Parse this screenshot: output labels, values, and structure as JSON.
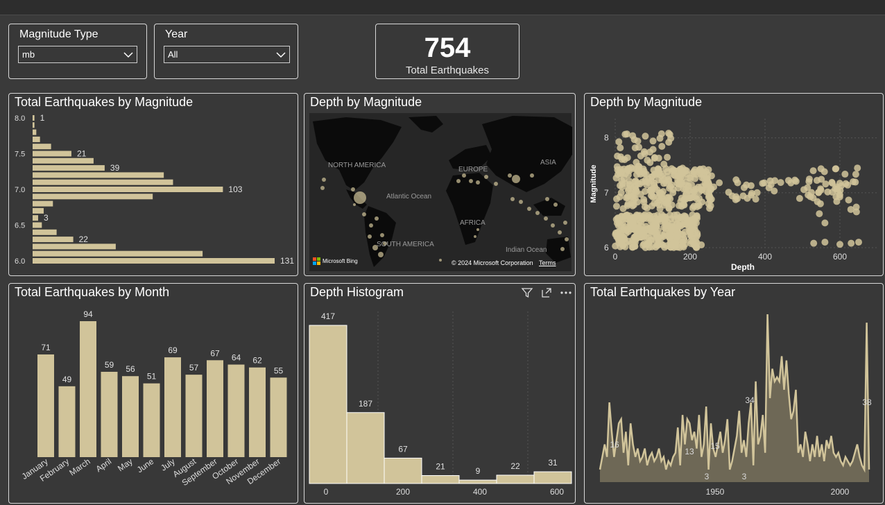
{
  "colors": {
    "bar": "#d1c49a",
    "background": "#383838",
    "border": "#d8d8d8",
    "text": "#ffffff",
    "muted": "#cccccc"
  },
  "slicers": {
    "magnitude": {
      "label": "Magnitude Type",
      "value": "mb"
    },
    "year": {
      "label": "Year",
      "value": "All"
    }
  },
  "kpi": {
    "value": "754",
    "label": "Total Earthquakes"
  },
  "magnitude_chart": {
    "title": "Total Earthquakes by Magnitude",
    "y_ticks": [
      "8.0",
      "7.5",
      "7.0",
      "6.5",
      "6.0"
    ],
    "data_labels": [
      "1",
      "21",
      "39",
      "103",
      "3",
      "22",
      "131"
    ]
  },
  "map_chart": {
    "title": "Depth by Magnitude",
    "labels": {
      "north_america": "NORTH AMERICA",
      "europe": "EUROPE",
      "asia": "ASIA",
      "atlantic": "Atlantic Ocean",
      "africa": "AFRICA",
      "south_america": "SOUTH AMERICA",
      "indian": "Indian Ocean"
    },
    "bing": "Microsoft Bing",
    "copyright": "© 2024 Microsoft Corporation",
    "terms": "Terms"
  },
  "scatter_chart": {
    "title": "Depth by Magnitude",
    "xlabel": "Depth",
    "ylabel": "Magnitude",
    "x_ticks": [
      "0",
      "200",
      "400",
      "600"
    ],
    "y_ticks": [
      "8",
      "7",
      "6"
    ]
  },
  "month_chart": {
    "title": "Total Earthquakes by Month"
  },
  "histogram_chart": {
    "title": "Depth Histogram",
    "x_ticks": [
      "0",
      "200",
      "400",
      "600"
    ]
  },
  "year_chart": {
    "title": "Total Earthquakes by Year",
    "x_ticks": [
      "1950",
      "2000"
    ],
    "data_labels": [
      "16",
      "13",
      "15",
      "3",
      "3",
      "34",
      "38"
    ]
  },
  "chart_data": [
    {
      "type": "bar",
      "orientation": "horizontal",
      "title": "Total Earthquakes by Magnitude",
      "categories": [
        "8.0",
        "7.9",
        "7.8",
        "7.7",
        "7.6",
        "7.5",
        "7.4",
        "7.3",
        "7.2",
        "7.1",
        "7.0",
        "6.9",
        "6.8",
        "6.7",
        "6.6",
        "6.5",
        "6.4",
        "6.3",
        "6.2",
        "6.1",
        "6.0"
      ],
      "values": [
        1,
        1,
        2,
        4,
        10,
        21,
        33,
        39,
        71,
        76,
        103,
        65,
        11,
        6,
        3,
        5,
        13,
        22,
        45,
        92,
        131
      ],
      "xlim": [
        0,
        131
      ]
    },
    {
      "type": "bar",
      "title": "Total Earthquakes by Month",
      "categories": [
        "January",
        "February",
        "March",
        "April",
        "May",
        "June",
        "July",
        "August",
        "September",
        "October",
        "November",
        "December"
      ],
      "values": [
        71,
        49,
        94,
        59,
        56,
        51,
        69,
        57,
        67,
        64,
        62,
        55
      ],
      "ylim": [
        0,
        100
      ]
    },
    {
      "type": "bar",
      "title": "Depth Histogram",
      "categories": [
        "0",
        "100",
        "200",
        "300",
        "400",
        "500",
        "600"
      ],
      "values": [
        417,
        187,
        67,
        21,
        9,
        22,
        31
      ],
      "xlim": [
        0,
        700
      ]
    },
    {
      "type": "area",
      "title": "Total Earthquakes by Year",
      "x": [
        1900,
        1901,
        1902,
        1903,
        1904,
        1905,
        1906,
        1907,
        1908,
        1909,
        1910,
        1911,
        1912,
        1913,
        1914,
        1915,
        1916,
        1917,
        1918,
        1919,
        1920,
        1921,
        1922,
        1923,
        1924,
        1925,
        1926,
        1927,
        1928,
        1929,
        1930,
        1931,
        1932,
        1933,
        1934,
        1935,
        1936,
        1937,
        1938,
        1939,
        1940,
        1941,
        1942,
        1943,
        1944,
        1945,
        1946,
        1947,
        1948,
        1949,
        1950,
        1951,
        1952,
        1953,
        1954,
        1955,
        1956,
        1957,
        1958,
        1959,
        1960,
        1961,
        1962,
        1963,
        1964,
        1965,
        1966,
        1967,
        1968,
        1969,
        1970,
        1971,
        1972,
        1973,
        1974,
        1975,
        1976,
        1977,
        1978,
        1979,
        1980,
        1981,
        1982,
        1983,
        1984,
        1985,
        1986,
        1987,
        1988,
        1989,
        1990,
        1991,
        1992,
        1993,
        1994,
        1995,
        1996,
        1997,
        1998,
        1999,
        2000,
        2001,
        2002,
        2003,
        2004,
        2005,
        2006,
        2007,
        2008,
        2009,
        2010,
        2011
      ],
      "values": [
        3,
        6,
        9,
        6,
        19,
        12,
        6,
        10,
        14,
        15,
        7,
        12,
        4,
        14,
        9,
        6,
        8,
        5,
        6,
        8,
        4,
        6,
        7,
        5,
        6,
        8,
        5,
        6,
        3,
        5,
        4,
        6,
        7,
        13,
        4,
        16,
        9,
        15,
        14,
        10,
        12,
        8,
        16,
        6,
        9,
        18,
        3,
        14,
        8,
        6,
        9,
        12,
        7,
        10,
        15,
        3,
        5,
        8,
        11,
        17,
        7,
        10,
        6,
        14,
        19,
        4,
        24,
        9,
        11,
        16,
        7,
        40,
        20,
        27,
        24,
        25,
        24,
        30,
        22,
        29,
        21,
        15,
        17,
        22,
        7,
        9,
        6,
        12,
        9,
        5,
        9,
        6,
        11,
        6,
        9,
        5,
        10,
        8,
        11,
        7,
        6,
        7,
        5,
        4,
        6,
        5,
        4,
        5,
        7,
        9,
        6,
        4,
        3,
        38,
        3
      ],
      "xlim": [
        1900,
        2013
      ],
      "ylim": [
        0,
        40
      ]
    }
  ]
}
